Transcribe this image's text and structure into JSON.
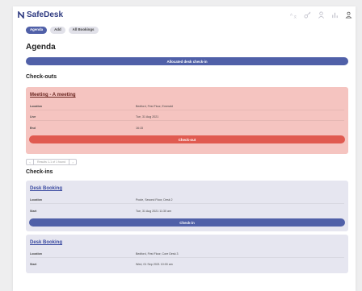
{
  "app": {
    "brand": "SafeDesk"
  },
  "header_icons": [
    "translate-icon",
    "key-icon",
    "user-icon",
    "chart-icon",
    "logout-icon"
  ],
  "tabs": [
    {
      "label": "Agenda",
      "active": true
    },
    {
      "label": "Add",
      "active": false
    },
    {
      "label": "All Bookings",
      "active": false
    }
  ],
  "page": {
    "title": "Agenda"
  },
  "allocated_button": "Allocated desk check-in",
  "checkouts": {
    "title": "Check-outs",
    "card": {
      "title": "Meeting - A meeting",
      "rows": [
        {
          "label": "Location",
          "value": "Bedford, First Floor, Emerald"
        },
        {
          "label": "Live",
          "value": "Tue, 31 Aug 2021"
        },
        {
          "label": "End",
          "value": "16:15"
        }
      ],
      "button": "Check-out"
    },
    "pager": {
      "prev": "‹",
      "text": "Results 1-1 of 1 found",
      "next": "›"
    }
  },
  "checkins": {
    "title": "Check-ins",
    "cards": [
      {
        "title": "Desk Booking",
        "rows": [
          {
            "label": "Location",
            "value": "Poole, Second Floor, Desk 2"
          },
          {
            "label": "Start",
            "value": "Tue, 31 Aug 2021 11:30 am"
          }
        ],
        "button": "Check-in"
      },
      {
        "title": "Desk Booking",
        "rows": [
          {
            "label": "Location",
            "value": "Bedford, First Floor, Core Desk 3"
          },
          {
            "label": "Start",
            "value": "Wed, 01 Sep 2021 10:00 am"
          }
        ]
      }
    ]
  },
  "colors": {
    "primary": "#5060a8",
    "danger": "#e05a50",
    "danger_bg": "#f5c4c0",
    "neutral_bg": "#e6e6f0"
  }
}
